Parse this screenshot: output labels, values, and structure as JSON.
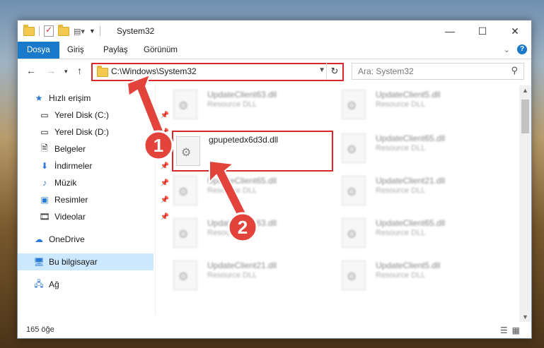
{
  "window": {
    "title": "System32"
  },
  "ribbon": {
    "tabs": [
      "Dosya",
      "Giriş",
      "Paylaş",
      "Görünüm"
    ]
  },
  "address": {
    "path": "C:\\Windows\\System32"
  },
  "search": {
    "placeholder": "Ara: System32"
  },
  "sidebar": {
    "items": [
      {
        "label": "Hızlı erişim",
        "icon": "star-icon"
      },
      {
        "label": "Yerel Disk (C:)",
        "icon": "drive-icon",
        "pinned": true
      },
      {
        "label": "Yerel Disk (D:)",
        "icon": "drive-icon",
        "pinned": true
      },
      {
        "label": "Belgeler",
        "icon": "documents-icon",
        "pinned": true
      },
      {
        "label": "İndirmeler",
        "icon": "downloads-icon",
        "pinned": true
      },
      {
        "label": "Müzik",
        "icon": "music-icon",
        "pinned": true
      },
      {
        "label": "Resimler",
        "icon": "pictures-icon",
        "pinned": true
      },
      {
        "label": "Videolar",
        "icon": "videos-icon",
        "pinned": true
      },
      {
        "label": "OneDrive",
        "icon": "cloud-icon"
      },
      {
        "label": "Bu bilgisayar",
        "icon": "computer-icon",
        "selected": true
      },
      {
        "label": "Ağ",
        "icon": "network-icon"
      }
    ]
  },
  "files": {
    "col1": [
      {
        "name": "UpdateClient63.dll",
        "desc": "Resource DLL"
      },
      {
        "name": "gpupetedx6d3d.dll",
        "desc": ""
      },
      {
        "name": "UpdateClient65.dll",
        "desc": "Resource DLL"
      },
      {
        "name": "UpdateClient63.dll",
        "desc": "Resource DLL"
      },
      {
        "name": "UpdateClient21.dll",
        "desc": "Resource DLL"
      }
    ],
    "col2": [
      {
        "name": "UpdateClient5.dll",
        "desc": "Resource DLL"
      },
      {
        "name": "UpdateClient65.dll",
        "desc": "Resource DLL"
      },
      {
        "name": "UpdateClient21.dll",
        "desc": "Resource DLL"
      },
      {
        "name": "UpdateClient65.dll",
        "desc": "Resource DLL"
      },
      {
        "name": "UpdateClient5.dll",
        "desc": "Resource DLL"
      }
    ]
  },
  "status": {
    "count": "165 öğe"
  },
  "annotations": {
    "marker1": "1",
    "marker2": "2",
    "color": "#e2433a"
  }
}
